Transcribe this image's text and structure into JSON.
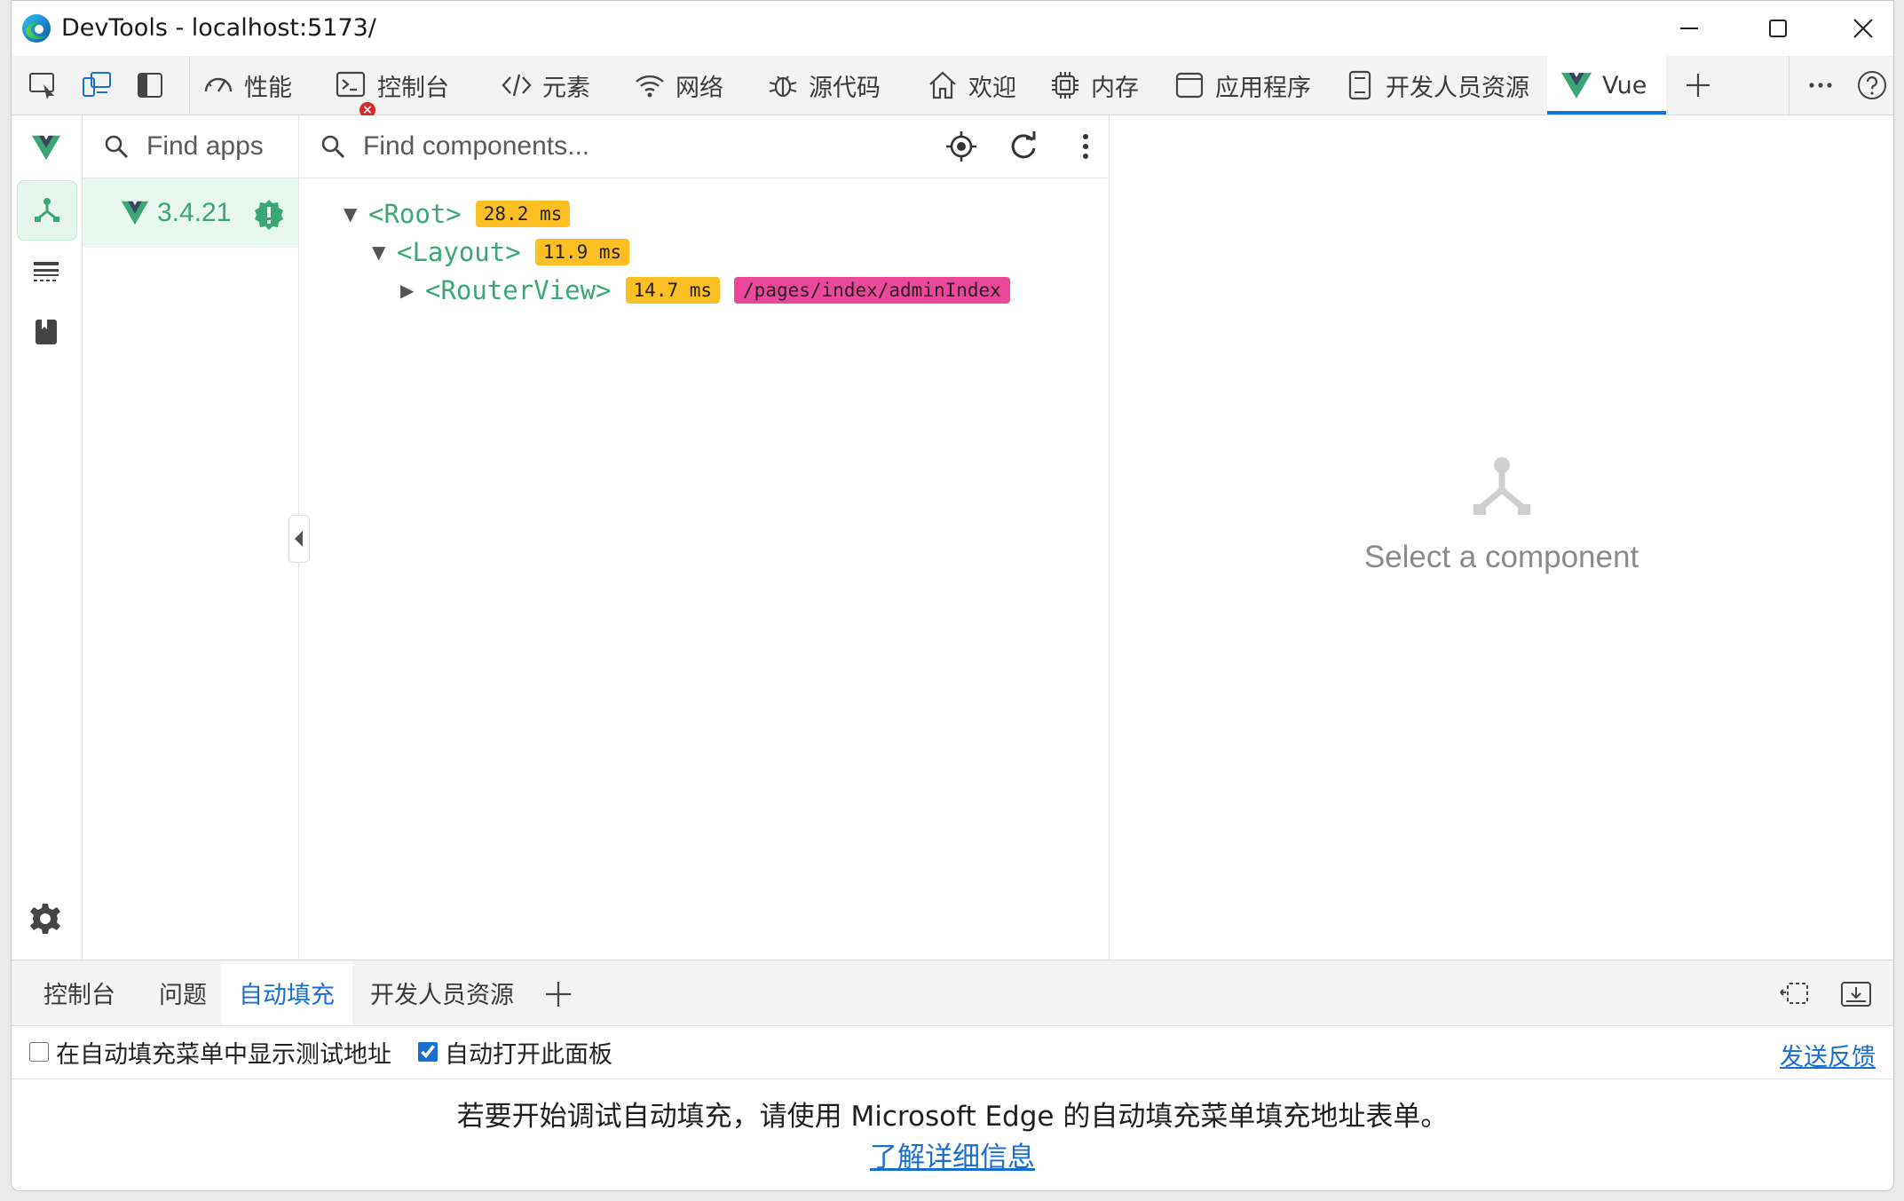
{
  "window": {
    "title": "DevTools - localhost:5173/"
  },
  "toolbar": {
    "tabs": [
      {
        "label": "性能",
        "icon": "performance-gauge-icon"
      },
      {
        "label": "控制台",
        "icon": "console-icon",
        "error_badge": "×"
      },
      {
        "label": "元素",
        "icon": "code-brackets-icon"
      },
      {
        "label": "网络",
        "icon": "wifi-icon"
      },
      {
        "label": "源代码",
        "icon": "bug-icon"
      },
      {
        "label": "欢迎",
        "icon": "home-icon"
      },
      {
        "label": "内存",
        "icon": "chip-icon"
      },
      {
        "label": "应用程序",
        "icon": "app-window-icon"
      },
      {
        "label": "开发人员资源",
        "icon": "document-icon"
      },
      {
        "label": "Vue",
        "icon": "vue-logo-icon",
        "active": true
      }
    ]
  },
  "vue": {
    "apps_search_placeholder": "Find apps",
    "app_version": "3.4.21",
    "components_search_placeholder": "Find components...",
    "tree": [
      {
        "name": "<Root>",
        "time": "28.2 ms",
        "expanded": true
      },
      {
        "name": "<Layout>",
        "time": "11.9 ms",
        "expanded": true
      },
      {
        "name": "<RouterView>",
        "time": "14.7 ms",
        "expanded": false,
        "route": "/pages/index/adminIndex"
      }
    ],
    "empty_state": "Select a component"
  },
  "drawer": {
    "tabs": [
      {
        "label": "控制台"
      },
      {
        "label": "问题"
      },
      {
        "label": "自动填充",
        "active": true
      },
      {
        "label": "开发人员资源"
      }
    ],
    "option_test_address": "在自动填充菜单中显示测试地址",
    "option_auto_open": "自动打开此面板",
    "feedback": "发送反馈",
    "message": "若要开始调试自动填充，请使用 Microsoft Edge 的自动填充菜单填充地址表单。",
    "learn_more": "了解详细信息"
  },
  "colors": {
    "vue_green": "#3ba776",
    "accent_blue": "#1a6ed0",
    "time_badge": "#fbbf24",
    "route_badge": "#ec4899"
  }
}
